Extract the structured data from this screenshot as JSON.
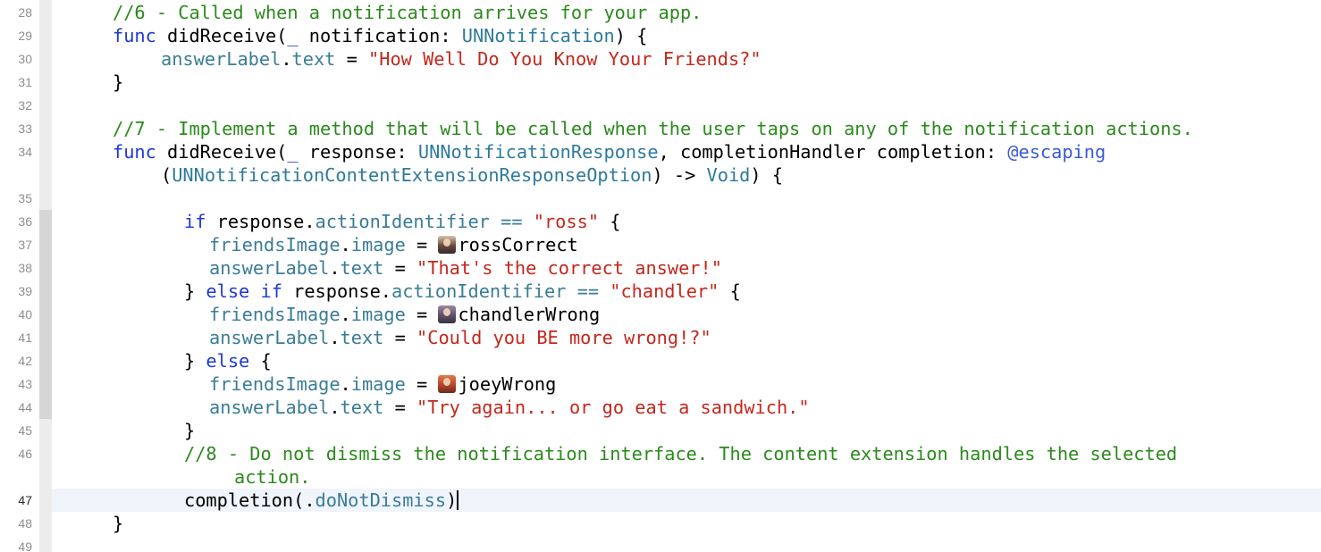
{
  "editor": {
    "lines": [
      {
        "num": "28",
        "segs": [
          [
            "c",
            "//6 - Called when a notification arrives for your app."
          ]
        ]
      },
      {
        "num": "29",
        "segs": [
          [
            "k2",
            "func"
          ],
          [
            "n",
            " didReceive("
          ],
          [
            "k2",
            "_"
          ],
          [
            "n",
            " notification: "
          ],
          [
            "t",
            "UNNotification"
          ],
          [
            "n",
            ") {"
          ]
        ]
      },
      {
        "num": "30",
        "segs": [
          [
            "p",
            "answerLabel"
          ],
          [
            "n",
            "."
          ],
          [
            "p",
            "text"
          ],
          [
            "n",
            " = "
          ],
          [
            "s",
            "\"How Well Do You Know Your Friends?\""
          ]
        ]
      },
      {
        "num": "31",
        "segs": [
          [
            "n",
            "}"
          ]
        ]
      },
      {
        "num": "32",
        "segs": []
      },
      {
        "num": "33",
        "segs": [
          [
            "c",
            "//7 - Implement a method that will be called when the user taps on any of the notification actions."
          ]
        ]
      },
      {
        "num": "34",
        "segs": [
          [
            "k2",
            "func"
          ],
          [
            "n",
            " didReceive("
          ],
          [
            "k2",
            "_"
          ],
          [
            "n",
            " response: "
          ],
          [
            "t",
            "UNNotificationResponse"
          ],
          [
            "n",
            ", completionHandler completion: "
          ],
          [
            "a",
            "@escaping"
          ]
        ]
      },
      {
        "num": "",
        "segs": [
          [
            "n",
            "("
          ],
          [
            "t",
            "UNNotificationContentExtensionResponseOption"
          ],
          [
            "n",
            ") -> "
          ],
          [
            "t",
            "Void"
          ],
          [
            "n",
            ") {"
          ]
        ]
      },
      {
        "num": "35",
        "segs": []
      },
      {
        "num": "36",
        "segs": [
          [
            "k2",
            "if"
          ],
          [
            "n",
            " response."
          ],
          [
            "p",
            "actionIdentifier"
          ],
          [
            "n",
            " "
          ],
          [
            "p",
            "=="
          ],
          [
            "n",
            " "
          ],
          [
            "s",
            "\"ross\""
          ],
          [
            "n",
            " {"
          ]
        ]
      },
      {
        "num": "37",
        "segs": [
          [
            "p",
            "friendsImage"
          ],
          [
            "n",
            "."
          ],
          [
            "p",
            "image"
          ],
          [
            "n",
            " = "
          ],
          [
            "icon",
            "ross"
          ],
          [
            "n",
            "rossCorrect"
          ]
        ]
      },
      {
        "num": "38",
        "segs": [
          [
            "p",
            "answerLabel"
          ],
          [
            "n",
            "."
          ],
          [
            "p",
            "text"
          ],
          [
            "n",
            " = "
          ],
          [
            "s",
            "\"That's the correct answer!\""
          ]
        ]
      },
      {
        "num": "39",
        "segs": [
          [
            "n",
            "} "
          ],
          [
            "k2",
            "else"
          ],
          [
            "n",
            " "
          ],
          [
            "k2",
            "if"
          ],
          [
            "n",
            " response."
          ],
          [
            "p",
            "actionIdentifier"
          ],
          [
            "n",
            " "
          ],
          [
            "p",
            "=="
          ],
          [
            "n",
            " "
          ],
          [
            "s",
            "\"chandler\""
          ],
          [
            "n",
            " {"
          ]
        ]
      },
      {
        "num": "40",
        "segs": [
          [
            "p",
            "friendsImage"
          ],
          [
            "n",
            "."
          ],
          [
            "p",
            "image"
          ],
          [
            "n",
            " = "
          ],
          [
            "icon",
            "chandler"
          ],
          [
            "n",
            "chandlerWrong"
          ]
        ]
      },
      {
        "num": "41",
        "segs": [
          [
            "p",
            "answerLabel"
          ],
          [
            "n",
            "."
          ],
          [
            "p",
            "text"
          ],
          [
            "n",
            " = "
          ],
          [
            "s",
            "\"Could you BE more wrong!?\""
          ]
        ]
      },
      {
        "num": "42",
        "segs": [
          [
            "n",
            "} "
          ],
          [
            "k2",
            "else"
          ],
          [
            "n",
            " {"
          ]
        ]
      },
      {
        "num": "43",
        "segs": [
          [
            "p",
            "friendsImage"
          ],
          [
            "n",
            "."
          ],
          [
            "p",
            "image"
          ],
          [
            "n",
            " = "
          ],
          [
            "icon",
            "joey"
          ],
          [
            "n",
            "joeyWrong"
          ]
        ]
      },
      {
        "num": "44",
        "segs": [
          [
            "p",
            "answerLabel"
          ],
          [
            "n",
            "."
          ],
          [
            "p",
            "text"
          ],
          [
            "n",
            " = "
          ],
          [
            "s",
            "\"Try again... or go eat a sandwich.\""
          ]
        ]
      },
      {
        "num": "45",
        "segs": [
          [
            "n",
            "}"
          ]
        ]
      },
      {
        "num": "46",
        "segs": [
          [
            "c",
            "//8 - Do not dismiss the notification interface. The content extension handles the selected"
          ]
        ]
      },
      {
        "num": "",
        "segs": [
          [
            "c",
            "action."
          ]
        ]
      },
      {
        "num": "47",
        "segs": [
          [
            "n",
            "completion(."
          ],
          [
            "p",
            "doNotDismiss"
          ],
          [
            "n",
            ")"
          ],
          [
            "caret",
            ""
          ]
        ]
      },
      {
        "num": "48",
        "segs": [
          [
            "n",
            "}"
          ]
        ]
      },
      {
        "num": "49",
        "segs": []
      }
    ],
    "active_line": "47",
    "image_literals": {
      "ross": "ross-photo-icon",
      "chandler": "chandler-photo-icon",
      "joey": "joey-photo-icon"
    }
  }
}
